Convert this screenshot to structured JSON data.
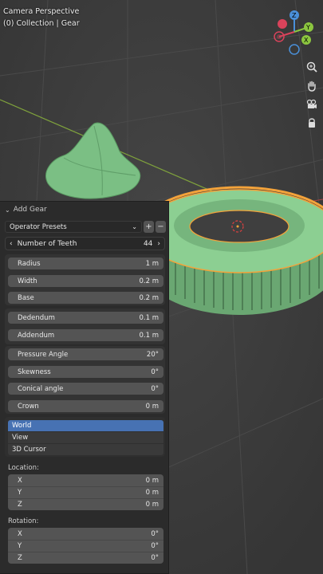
{
  "viewport": {
    "title": "Camera Perspective",
    "collection": "(0) Collection | Gear",
    "gizmo": {
      "x": "X",
      "y": "Y",
      "z": "Z"
    }
  },
  "panel": {
    "header": "Add Gear",
    "presets": {
      "label": "Operator Presets"
    },
    "teeth": {
      "label": "Number of Teeth",
      "value": "44"
    },
    "group1": [
      {
        "label": "Radius",
        "value": "1 m"
      },
      {
        "label": "Width",
        "value": "0.2 m"
      },
      {
        "label": "Base",
        "value": "0.2 m"
      }
    ],
    "group2": [
      {
        "label": "Dedendum",
        "value": "0.1 m"
      },
      {
        "label": "Addendum",
        "value": "0.1 m"
      }
    ],
    "group3": [
      {
        "label": "Pressure Angle",
        "value": "20°"
      },
      {
        "label": "Skewness",
        "value": "0°"
      },
      {
        "label": "Conical angle",
        "value": "0°"
      },
      {
        "label": "Crown",
        "value": "0 m"
      }
    ],
    "align": [
      "World",
      "View",
      "3D Cursor"
    ],
    "location": {
      "label": "Location:",
      "rows": [
        {
          "axis": "X",
          "value": "0 m"
        },
        {
          "axis": "Y",
          "value": "0 m"
        },
        {
          "axis": "Z",
          "value": "0 m"
        }
      ]
    },
    "rotation": {
      "label": "Rotation:",
      "rows": [
        {
          "axis": "X",
          "value": "0°"
        },
        {
          "axis": "Y",
          "value": "0°"
        },
        {
          "axis": "Z",
          "value": "0°"
        }
      ]
    }
  },
  "colors": {
    "accent": "#4772b3",
    "selection": "#f4a33a",
    "mesh": "#86c58c"
  }
}
